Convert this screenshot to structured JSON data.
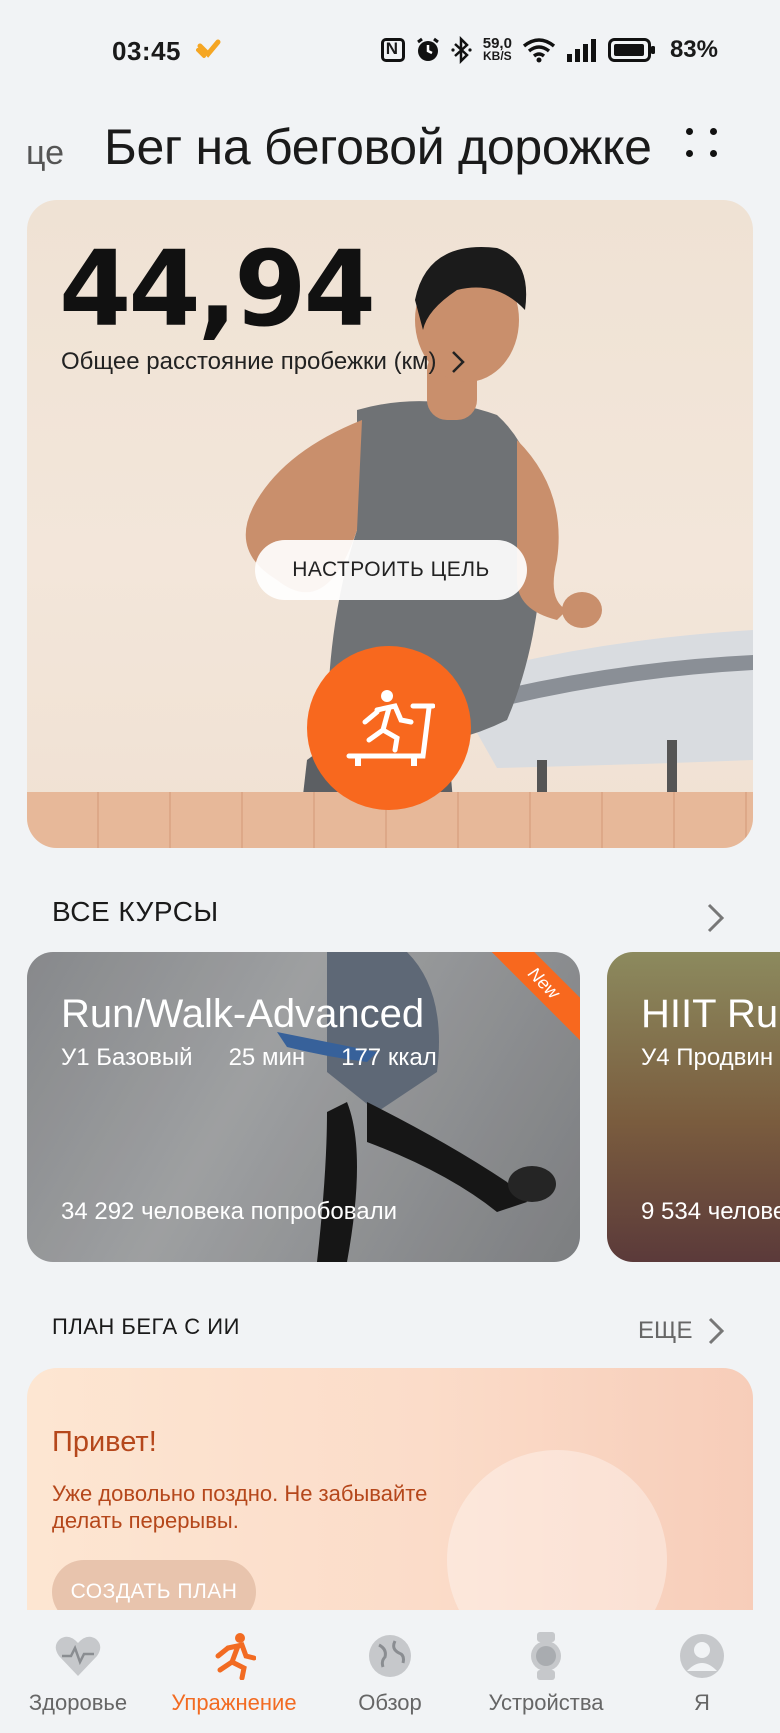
{
  "status_bar": {
    "time": "03:45",
    "net_speed_value": "59,0",
    "net_speed_unit": "KB/S",
    "battery": "83%"
  },
  "header": {
    "prev_tab": "це",
    "title": "Бег на беговой дорожке",
    "more_icon": "more-dots-icon"
  },
  "hero": {
    "distance_value": "44,94",
    "distance_label": "Общее расстояние пробежки (км)",
    "set_goal_label": "НАСТРОИТЬ ЦЕЛЬ",
    "start_icon": "treadmill-runner-icon"
  },
  "courses": {
    "section_title": "ВСЕ КУРСЫ",
    "items": [
      {
        "title": "Run/Walk-Advanced",
        "level": "У1 Базовый",
        "duration": "25 мин",
        "calories": "177 ккал",
        "tried": "34 292 человека попробовали",
        "badge": "New"
      },
      {
        "title": "HIIT Run",
        "level": "У4 Продвин",
        "tried": "9 534 челове"
      }
    ]
  },
  "ai_plan": {
    "section_title": "ПЛАН БЕГА С ИИ",
    "more_label": "ЕЩЕ",
    "greeting": "Привет!",
    "message": "Уже довольно поздно. Не забывайте делать перерывы.",
    "create_label": "СОЗДАТЬ ПЛАН"
  },
  "bottom_nav": [
    {
      "label": "Здоровье",
      "icon": "heart-pulse-icon",
      "active": false
    },
    {
      "label": "Упражнение",
      "icon": "running-icon",
      "active": true
    },
    {
      "label": "Обзор",
      "icon": "globe-icon",
      "active": false
    },
    {
      "label": "Устройства",
      "icon": "watch-icon",
      "active": false
    },
    {
      "label": "Я",
      "icon": "profile-icon",
      "active": false
    }
  ],
  "colors": {
    "accent": "#f8681e",
    "background": "#f1f3f5",
    "plan_text": "#b5471b"
  }
}
